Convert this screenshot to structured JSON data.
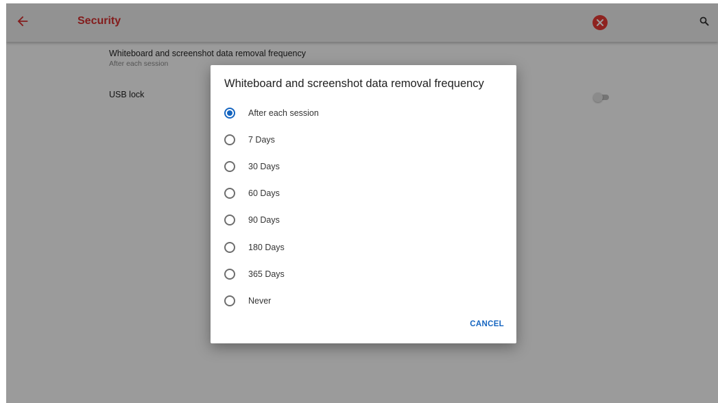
{
  "appbar": {
    "title": "Security",
    "back_icon": "arrow-left-icon",
    "close_icon": "close-circle-icon",
    "search_icon": "search-icon",
    "accent_color": "#d32f2f"
  },
  "settings": {
    "removal": {
      "title": "Whiteboard and screenshot data removal frequency",
      "subtitle": "After each session"
    },
    "usb": {
      "title": "USB lock",
      "enabled": false
    }
  },
  "dialog": {
    "title": "Whiteboard and screenshot data removal frequency",
    "options": [
      {
        "label": "After each session",
        "selected": true
      },
      {
        "label": "7 Days",
        "selected": false
      },
      {
        "label": "30 Days",
        "selected": false
      },
      {
        "label": "60 Days",
        "selected": false
      },
      {
        "label": "90 Days",
        "selected": false
      },
      {
        "label": "180 Days",
        "selected": false
      },
      {
        "label": "365 Days",
        "selected": false
      },
      {
        "label": "Never",
        "selected": false
      }
    ],
    "cancel_label": "CANCEL",
    "radio_color": "#1565c0"
  }
}
